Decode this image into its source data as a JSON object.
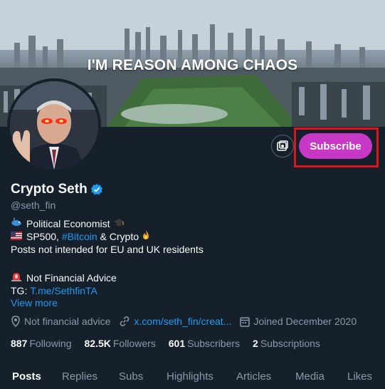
{
  "banner": {
    "text": "I'M REASON AMONG CHAOS"
  },
  "profile": {
    "display_name": "Crypto Seth",
    "handle": "@seth_fin",
    "subscribe_label": "Subscribe"
  },
  "bio": {
    "line1": "Political Economist",
    "line2_prefix": "SP500, ",
    "line2_hashtag": "#Bitcoin",
    "line2_suffix": " & Crypto",
    "line3": "Posts not intended for EU and UK residents",
    "line4": "Not Financial Advice",
    "line5_prefix": "TG: ",
    "line5_link": "T.me/SethfinTA",
    "view_more": "View more"
  },
  "meta": {
    "location": "Not financial advice",
    "website": "x.com/seth_fin/creat...",
    "joined": "Joined December 2020"
  },
  "stats": {
    "following_count": "887",
    "following_label": "Following",
    "followers_count": "82.5K",
    "followers_label": "Followers",
    "subscribers_count": "601",
    "subscribers_label": "Subscribers",
    "subscriptions_count": "2",
    "subscriptions_label": "Subscriptions"
  },
  "tabs": [
    "Posts",
    "Replies",
    "Subs",
    "Highlights",
    "Articles",
    "Media",
    "Likes"
  ],
  "colors": {
    "background": "#15202b",
    "accent": "#1d9bf0",
    "subscribe": "#c738c4",
    "highlight_box": "#e0131b"
  }
}
